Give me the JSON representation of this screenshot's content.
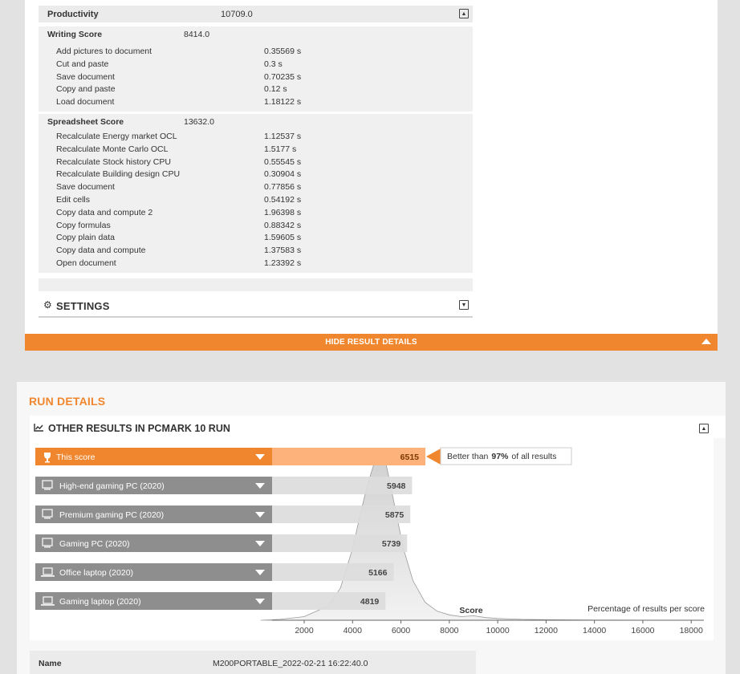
{
  "productivity": {
    "label": "Productivity",
    "value": "10709.0"
  },
  "writing": {
    "label": "Writing Score",
    "value": "8414.0",
    "rows": [
      {
        "name": "Add pictures to document",
        "value": "0.35569 s"
      },
      {
        "name": "Cut and paste",
        "value": "0.3 s"
      },
      {
        "name": "Save document",
        "value": "0.70235 s"
      },
      {
        "name": "Copy and paste",
        "value": "0.12 s"
      },
      {
        "name": "Load document",
        "value": "1.18122 s"
      }
    ]
  },
  "spreadsheet": {
    "label": "Spreadsheet Score",
    "value": "13632.0",
    "rows": [
      {
        "name": "Recalculate Energy market OCL",
        "value": "1.12537 s"
      },
      {
        "name": "Recalculate Monte Carlo OCL",
        "value": "1.5177 s"
      },
      {
        "name": "Recalculate Stock history CPU",
        "value": "0.55545 s"
      },
      {
        "name": "Recalculate Building design CPU",
        "value": "0.30904 s"
      },
      {
        "name": "Save document",
        "value": "0.77856 s"
      },
      {
        "name": "Edit cells",
        "value": "0.54192 s"
      },
      {
        "name": "Copy data and compute 2",
        "value": "1.96398 s"
      },
      {
        "name": "Copy formulas",
        "value": "0.88342 s"
      },
      {
        "name": "Copy plain data",
        "value": "1.59605 s"
      },
      {
        "name": "Copy data and compute",
        "value": "1.37583 s"
      },
      {
        "name": "Open document",
        "value": "1.23392 s"
      }
    ]
  },
  "settings": {
    "title": "SETTINGS"
  },
  "hide_details": {
    "label": "HIDE RESULT DETAILS"
  },
  "run_details": {
    "title": "RUN DETAILS",
    "other_results_title": "OTHER RESULTS IN PCMARK 10 RUN"
  },
  "name_row": {
    "label": "Name",
    "value": "M200PORTABLE_2022-02-21 16:22:40.0"
  },
  "colors": {
    "accent": "#f0862d",
    "accent_light": "#fcb27a",
    "ref_bar": "#8e8e8e",
    "score_bar": "#dcdcdc",
    "curve": "#dadada"
  },
  "chart_data": {
    "type": "bar",
    "categories": [
      "This score",
      "High-end gaming PC (2020)",
      "Premium gaming PC (2020)",
      "Gaming PC (2020)",
      "Office laptop (2020)",
      "Gaming laptop (2020)"
    ],
    "category_icons": [
      "trophy-icon",
      "desktop-icon",
      "desktop-icon",
      "desktop-icon",
      "laptop-icon",
      "laptop-icon"
    ],
    "values": [
      6515,
      5948,
      5875,
      5739,
      5166,
      4819
    ],
    "value_labels": [
      "6515",
      "5948",
      "5875",
      "5739",
      "5166",
      "4819"
    ],
    "highlight_index": 0,
    "better_than": {
      "prefix": "Better than",
      "percent": "97%",
      "suffix": "of all results"
    },
    "xlabel": "Score",
    "ylabel": "Percentage of results per score",
    "xlim": [
      0,
      18000
    ],
    "x_ticks": [
      2000,
      4000,
      6000,
      8000,
      10000,
      12000,
      14000,
      16000,
      18000
    ],
    "x_tick_labels": [
      "2000",
      "4000",
      "6000",
      "8000",
      "10000",
      "12000",
      "14000",
      "16000",
      "18000"
    ],
    "distribution": {
      "x": [
        200,
        1000,
        2000,
        3000,
        3500,
        4000,
        4300,
        4600,
        4900,
        5100,
        5300,
        5500,
        5800,
        6100,
        6500,
        7000,
        7500,
        8000,
        8500,
        9000,
        9500,
        10000,
        11000,
        12000,
        14000,
        16000,
        18000
      ],
      "y": [
        0,
        0.5,
        2,
        8,
        18,
        40,
        58,
        75,
        88,
        95,
        92,
        80,
        60,
        40,
        22,
        10,
        5,
        3,
        2,
        2.5,
        1.5,
        1,
        0.5,
        0.3,
        0.1,
        0.05,
        0
      ]
    }
  }
}
